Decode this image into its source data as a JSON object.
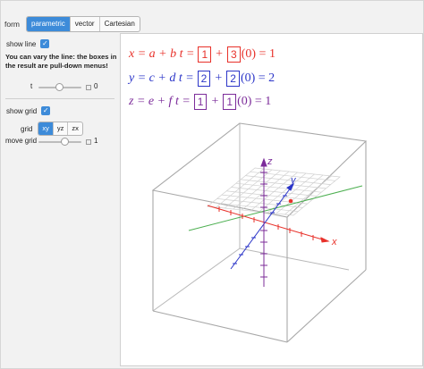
{
  "form": {
    "label": "form",
    "options": [
      "parametric",
      "vector",
      "Cartesian"
    ],
    "selected": "parametric"
  },
  "controls": {
    "show_line_label": "show line",
    "show_line_checked": true,
    "note": "You can vary the line: the boxes in the result are pull-down menus!",
    "t_slider": {
      "min_label": "t",
      "value": "0",
      "fraction": 0.5
    },
    "show_grid_label": "show grid",
    "show_grid_checked": true,
    "grid_label": "grid",
    "grid_options": [
      "xy",
      "yz",
      "zx"
    ],
    "grid_selected": "xy",
    "move_grid_label": "move grid",
    "move_grid": {
      "value": "1",
      "fraction": 0.58
    }
  },
  "equations": [
    {
      "color": "#e8312a",
      "lhs": "x = a + b t =",
      "box1": "1",
      "plus": "+",
      "box2": "3",
      "tail": "(0) = 1"
    },
    {
      "color": "#2b35c8",
      "lhs": "y = c + d t =",
      "box1": "2",
      "plus": "+",
      "box2": "2",
      "tail": "(0) = 2"
    },
    {
      "color": "#7c2c9a",
      "lhs": "z = e + f t =",
      "box1": "1",
      "plus": "+",
      "box2": "1",
      "tail": "(0) = 1"
    }
  ],
  "axes": {
    "x_label": "x",
    "y_label": "y",
    "z_label": "z",
    "x_color": "#e8312a",
    "y_color": "#2b35c8",
    "z_color": "#7c2c9a",
    "line_color": "#4caf50"
  }
}
